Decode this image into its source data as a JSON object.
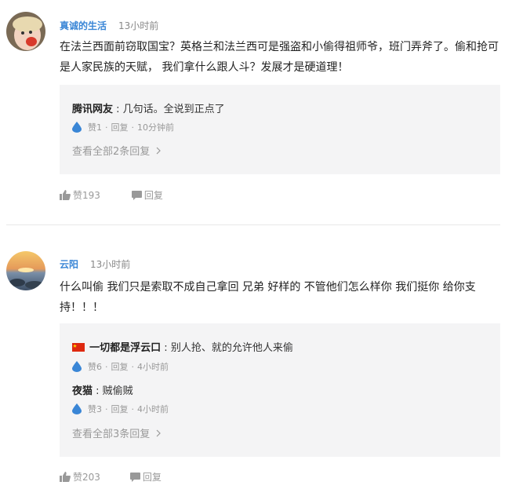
{
  "comments": [
    {
      "username": "真诚的生活",
      "time": "13小时前",
      "text": "在法兰西面前窃取国宝？英格兰和法兰西可是强盗和小偷得祖师爷，班门弄斧了。偷和抢可是人家民族的天赋， 我们拿什么跟人斗？发展才是硬道理！",
      "replies": [
        {
          "name": "腾讯网友",
          "text": "几句话。全说到正点了",
          "likes": "赞1",
          "reply_label": "回复",
          "time": "10分钟前"
        }
      ],
      "view_all": "查看全部2条回复",
      "likes": "赞193",
      "reply_label": "回复"
    },
    {
      "username": "云阳",
      "time": "13小时前",
      "text": "什么叫偷 我们只是索取不成自己拿回 兄弟 好样的 不管他们怎么样你 我们挺你 给你支持！！！",
      "replies": [
        {
          "name": "一切都是浮云口",
          "text": "别人抢、就的允许他人来偷",
          "likes": "赞6",
          "reply_label": "回复",
          "time": "4小时前"
        },
        {
          "name": "夜猫",
          "text": "贼偷贼",
          "likes": "赞3",
          "reply_label": "回复",
          "time": "4小时前"
        }
      ],
      "view_all": "查看全部3条回复",
      "likes": "赞203",
      "reply_label": "回复"
    }
  ],
  "icons": {
    "like": "thumbs-up-icon",
    "reply": "speech-bubble-icon",
    "drop": "water-drop-icon",
    "chevron": "chevron-right-icon",
    "flag": "china-flag-icon"
  },
  "colors": {
    "username": "#3a86d6",
    "drop": "#3a86d6",
    "reply_bg": "#f4f4f5"
  }
}
